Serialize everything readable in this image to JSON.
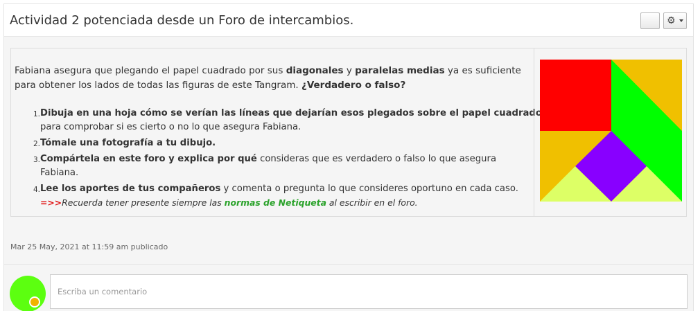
{
  "post": {
    "title": "Actividad 2 potenciada desde un Foro de intercambios.",
    "header_buttons": {
      "blank_label": "",
      "menu_icon": "gear-icon"
    },
    "intro": {
      "t1": "Fabiana asegura que plegando el papel cuadrado por sus ",
      "b1": "diagonales",
      "t2": " y ",
      "b2": "paralelas medias",
      "t3": " ya es suficiente para obtener los lados de todas las figuras de este Tangram. ",
      "b3": "¿Verdadero o falso?"
    },
    "steps": [
      {
        "num": "1.",
        "bold": "Dibuja en una hoja cómo se verían las líneas que dejarían esos plegados sobre el papel cuadrado",
        "rest": "para comprobar si es cierto o no lo que asegura Fabiana."
      },
      {
        "num": "2.",
        "bold": "Tómale una fotografía a tu dibujo."
      },
      {
        "num": "3.",
        "bold": "Compártela en este foro y explica por qué",
        "rest": " consideras que es verdadero o falso lo que asegura",
        "rest2": "Fabiana."
      },
      {
        "num": "4.",
        "bold": "Lee los aportes de tus compañeros",
        "rest": " y comenta o pregunta lo que consideres oportuno en cada caso.",
        "note_arrow": "=>>",
        "note_a": "Recuerda tener presente siempre las ",
        "note_link": "normas de Netiqueta",
        "note_b": " al escribir en el foro."
      }
    ],
    "tangram_colors": {
      "red": "#ff0000",
      "orange": "#f0c000",
      "green": "#00ff00",
      "purple": "#8800ff",
      "lime": "#ddff66"
    },
    "meta": "Mar 25 May, 2021 at 11:59 am publicado",
    "comment": {
      "placeholder": "Escriba un comentario",
      "avatar_color": "#5cff10"
    }
  }
}
